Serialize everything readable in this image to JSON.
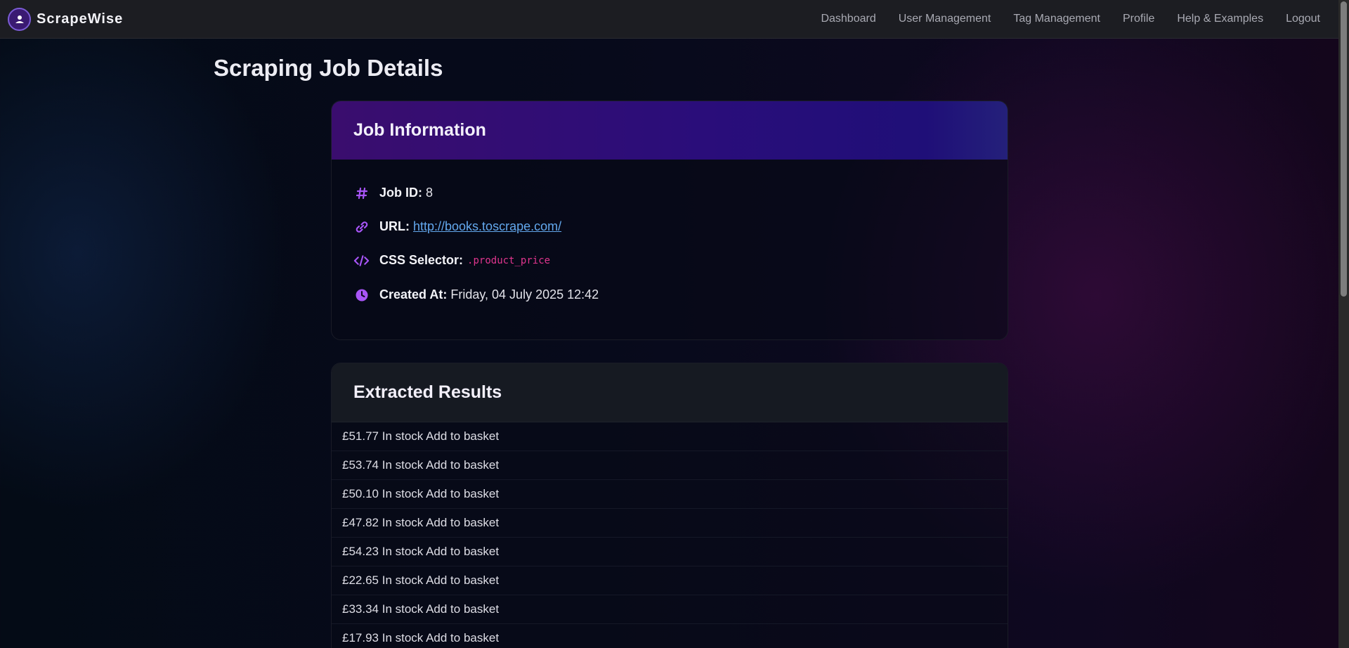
{
  "brand": {
    "name": "ScrapeWise"
  },
  "nav": {
    "items": [
      "Dashboard",
      "User Management",
      "Tag Management",
      "Profile",
      "Help & Examples",
      "Logout"
    ]
  },
  "page": {
    "title": "Scraping Job Details"
  },
  "job_info": {
    "heading": "Job Information",
    "job_id": {
      "label": "Job ID:",
      "value": "8",
      "icon": "hash-icon"
    },
    "url": {
      "label": "URL:",
      "value": "http://books.toscrape.com/",
      "icon": "link-icon"
    },
    "css_selector": {
      "label": "CSS Selector:",
      "value": ".product_price",
      "icon": "code-icon"
    },
    "created_at": {
      "label": "Created At:",
      "value": "Friday, 04 July 2025 12:42",
      "icon": "clock-icon"
    }
  },
  "results": {
    "heading": "Extracted Results",
    "items": [
      "£51.77 In stock Add to basket",
      "£53.74 In stock Add to basket",
      "£50.10 In stock Add to basket",
      "£47.82 In stock Add to basket",
      "£54.23 In stock Add to basket",
      "£22.65 In stock Add to basket",
      "£33.34 In stock Add to basket",
      "£17.93 In stock Add to basket"
    ]
  },
  "colors": {
    "accent": "#a855f7",
    "link": "#63a8ee",
    "code": "#e0358e",
    "header_gradient_start": "#3a0d6e",
    "header_gradient_end": "#24207a"
  }
}
